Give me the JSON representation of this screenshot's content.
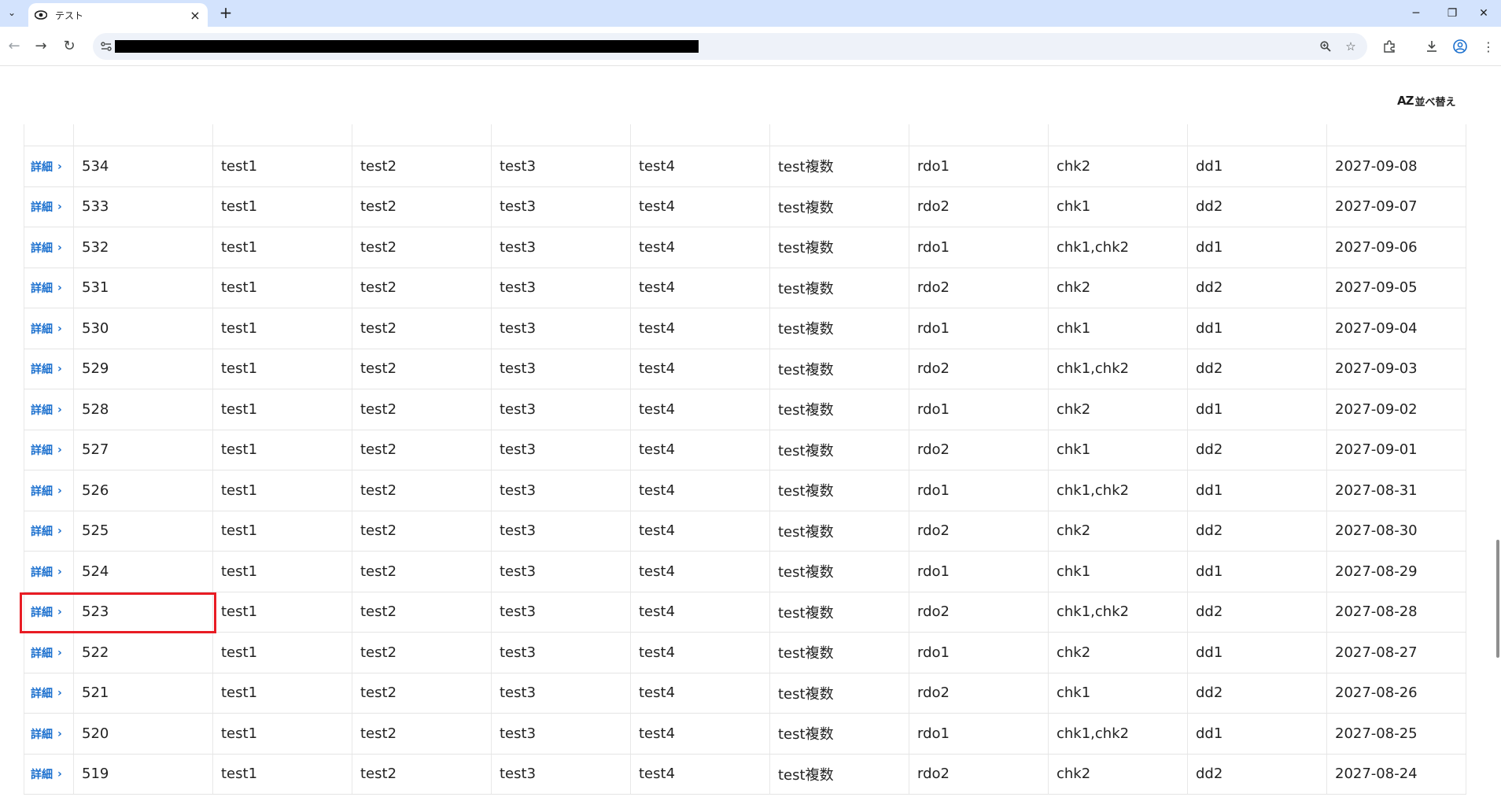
{
  "browser": {
    "tab_title": "テスト",
    "tab_close": "×",
    "new_tab": "+",
    "window": {
      "minimize": "─",
      "restore": "❐",
      "close": "✕"
    },
    "nav": {
      "back": "←",
      "forward": "→",
      "reload": "↻"
    },
    "url_redacted": true
  },
  "page": {
    "sort_icon": "AZ",
    "sort_label": "並べ替え"
  },
  "table": {
    "detail_label": "詳細",
    "chevron": "›",
    "rows": [
      {
        "id": "534",
        "c1": "test1",
        "c2": "test2",
        "c3": "test3",
        "c4": "test4",
        "c5": "test複数",
        "radio": "rdo1",
        "check": "chk2",
        "dropdown": "dd1",
        "date": "2027-09-08"
      },
      {
        "id": "533",
        "c1": "test1",
        "c2": "test2",
        "c3": "test3",
        "c4": "test4",
        "c5": "test複数",
        "radio": "rdo2",
        "check": "chk1",
        "dropdown": "dd2",
        "date": "2027-09-07"
      },
      {
        "id": "532",
        "c1": "test1",
        "c2": "test2",
        "c3": "test3",
        "c4": "test4",
        "c5": "test複数",
        "radio": "rdo1",
        "check": "chk1,chk2",
        "dropdown": "dd1",
        "date": "2027-09-06"
      },
      {
        "id": "531",
        "c1": "test1",
        "c2": "test2",
        "c3": "test3",
        "c4": "test4",
        "c5": "test複数",
        "radio": "rdo2",
        "check": "chk2",
        "dropdown": "dd2",
        "date": "2027-09-05"
      },
      {
        "id": "530",
        "c1": "test1",
        "c2": "test2",
        "c3": "test3",
        "c4": "test4",
        "c5": "test複数",
        "radio": "rdo1",
        "check": "chk1",
        "dropdown": "dd1",
        "date": "2027-09-04"
      },
      {
        "id": "529",
        "c1": "test1",
        "c2": "test2",
        "c3": "test3",
        "c4": "test4",
        "c5": "test複数",
        "radio": "rdo2",
        "check": "chk1,chk2",
        "dropdown": "dd2",
        "date": "2027-09-03"
      },
      {
        "id": "528",
        "c1": "test1",
        "c2": "test2",
        "c3": "test3",
        "c4": "test4",
        "c5": "test複数",
        "radio": "rdo1",
        "check": "chk2",
        "dropdown": "dd1",
        "date": "2027-09-02"
      },
      {
        "id": "527",
        "c1": "test1",
        "c2": "test2",
        "c3": "test3",
        "c4": "test4",
        "c5": "test複数",
        "radio": "rdo2",
        "check": "chk1",
        "dropdown": "dd2",
        "date": "2027-09-01"
      },
      {
        "id": "526",
        "c1": "test1",
        "c2": "test2",
        "c3": "test3",
        "c4": "test4",
        "c5": "test複数",
        "radio": "rdo1",
        "check": "chk1,chk2",
        "dropdown": "dd1",
        "date": "2027-08-31"
      },
      {
        "id": "525",
        "c1": "test1",
        "c2": "test2",
        "c3": "test3",
        "c4": "test4",
        "c5": "test複数",
        "radio": "rdo2",
        "check": "chk2",
        "dropdown": "dd2",
        "date": "2027-08-30"
      },
      {
        "id": "524",
        "c1": "test1",
        "c2": "test2",
        "c3": "test3",
        "c4": "test4",
        "c5": "test複数",
        "radio": "rdo1",
        "check": "chk1",
        "dropdown": "dd1",
        "date": "2027-08-29"
      },
      {
        "id": "523",
        "c1": "test1",
        "c2": "test2",
        "c3": "test3",
        "c4": "test4",
        "c5": "test複数",
        "radio": "rdo2",
        "check": "chk1,chk2",
        "dropdown": "dd2",
        "date": "2027-08-28"
      },
      {
        "id": "522",
        "c1": "test1",
        "c2": "test2",
        "c3": "test3",
        "c4": "test4",
        "c5": "test複数",
        "radio": "rdo1",
        "check": "chk2",
        "dropdown": "dd1",
        "date": "2027-08-27"
      },
      {
        "id": "521",
        "c1": "test1",
        "c2": "test2",
        "c3": "test3",
        "c4": "test4",
        "c5": "test複数",
        "radio": "rdo2",
        "check": "chk1",
        "dropdown": "dd2",
        "date": "2027-08-26"
      },
      {
        "id": "520",
        "c1": "test1",
        "c2": "test2",
        "c3": "test3",
        "c4": "test4",
        "c5": "test複数",
        "radio": "rdo1",
        "check": "chk1,chk2",
        "dropdown": "dd1",
        "date": "2027-08-25"
      },
      {
        "id": "519",
        "c1": "test1",
        "c2": "test2",
        "c3": "test3",
        "c4": "test4",
        "c5": "test複数",
        "radio": "rdo2",
        "check": "chk2",
        "dropdown": "dd2",
        "date": "2027-08-24"
      }
    ]
  },
  "colors": {
    "accent": "#1a6fce",
    "highlight": "#e81c24",
    "tabstrip": "#d3e3fd"
  }
}
